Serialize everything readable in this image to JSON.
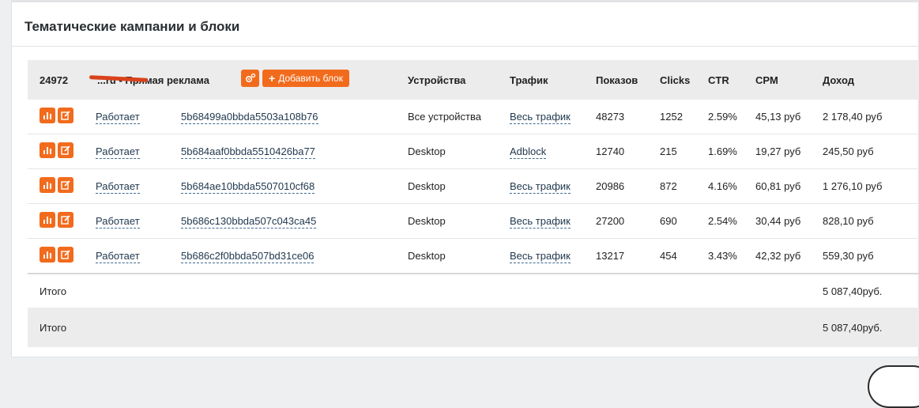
{
  "panel": {
    "title": "Тематические кампании и блоки"
  },
  "campaign": {
    "id": "24972",
    "name": "...ru - Прямая реклама",
    "add_block_label": "Добавить блок"
  },
  "columns": {
    "devices": "Устройства",
    "traffic": "Трафик",
    "impressions": "Показов",
    "clicks": "Clicks",
    "ctr": "CTR",
    "cpm": "CPM",
    "income": "Доход"
  },
  "rows": [
    {
      "status": "Работает",
      "id": "5b68499a0bbda5503a108b76",
      "devices": "Все устройства",
      "traffic": "Весь трафик",
      "impressions": "48273",
      "clicks": "1252",
      "ctr": "2.59%",
      "cpm": "45,13 руб",
      "income": "2 178,40 руб"
    },
    {
      "status": "Работает",
      "id": "5b684aaf0bbda5510426ba77",
      "devices": "Desktop",
      "traffic": "Adblock",
      "impressions": "12740",
      "clicks": "215",
      "ctr": "1.69%",
      "cpm": "19,27 руб",
      "income": "245,50 руб"
    },
    {
      "status": "Работает",
      "id": "5b684ae10bbda5507010cf68",
      "devices": "Desktop",
      "traffic": "Весь трафик",
      "impressions": "20986",
      "clicks": "872",
      "ctr": "4.16%",
      "cpm": "60,81 руб",
      "income": "1 276,10 руб"
    },
    {
      "status": "Работает",
      "id": "5b686c130bbda507c043ca45",
      "devices": "Desktop",
      "traffic": "Весь трафик",
      "impressions": "27200",
      "clicks": "690",
      "ctr": "2.54%",
      "cpm": "30,44 руб",
      "income": "828,10 руб"
    },
    {
      "status": "Работает",
      "id": "5b686c2f0bbda507bd31ce06",
      "devices": "Desktop",
      "traffic": "Весь трафик",
      "impressions": "13217",
      "clicks": "454",
      "ctr": "3.43%",
      "cpm": "42,32 руб",
      "income": "559,30 руб"
    }
  ],
  "totals": [
    {
      "label": "Итого",
      "income": "5 087,40руб."
    },
    {
      "label": "Итого",
      "income": "5 087,40руб."
    }
  ],
  "colors": {
    "accent": "#f26b1d",
    "link_underline": "#3d6a92",
    "header_bg": "#ececec",
    "redaction": "#d9421c"
  },
  "icons": {
    "settings": "gear-icon",
    "add": "plus-icon",
    "stats": "bar-chart-icon",
    "edit": "edit-icon"
  }
}
